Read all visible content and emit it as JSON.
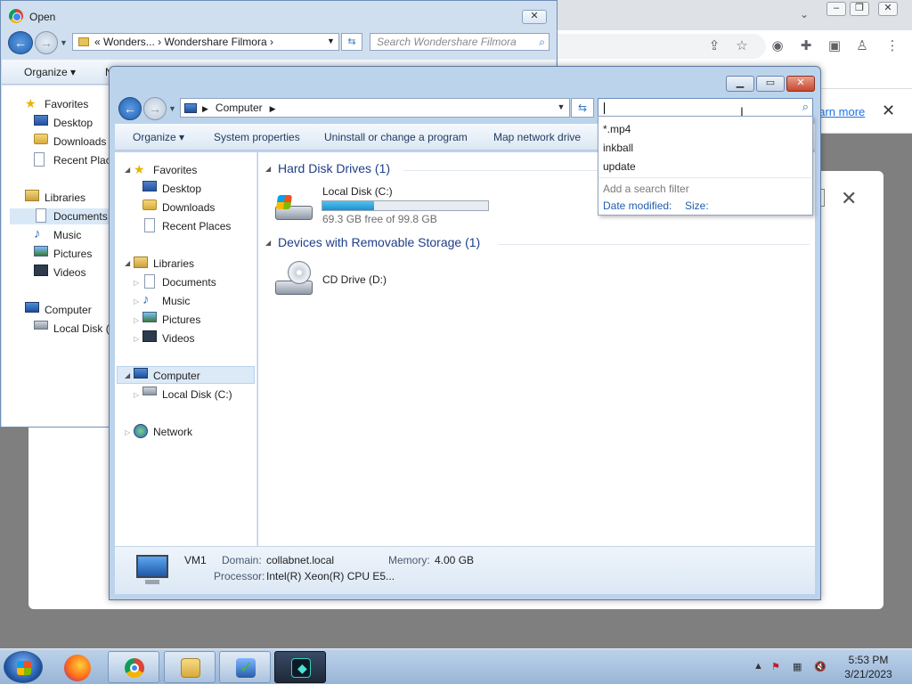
{
  "chrome": {
    "learn_more": "earn more",
    "close_glyph": "✕"
  },
  "open_dialog": {
    "title": "Open",
    "breadcrumb": "« Wonders... › Wondershare Filmora ›",
    "search_placeholder": "Search Wondershare Filmora",
    "commands": [
      "Organize ▾",
      "N"
    ],
    "nav": {
      "favorites": "Favorites",
      "desktop": "Desktop",
      "downloads": "Downloads",
      "recent": "Recent Place",
      "libraries": "Libraries",
      "documents": "Documents",
      "music": "Music",
      "pictures": "Pictures",
      "videos": "Videos",
      "computer": "Computer",
      "local_disk": "Local Disk (C"
    }
  },
  "explorer": {
    "address": "Computer",
    "commands": {
      "organize": "Organize ▾",
      "system_properties": "System properties",
      "uninstall": "Uninstall or change a program",
      "map_drive": "Map network drive"
    },
    "nav": {
      "favorites": "Favorites",
      "desktop": "Desktop",
      "downloads": "Downloads",
      "recent": "Recent Places",
      "libraries": "Libraries",
      "documents": "Documents",
      "music": "Music",
      "pictures": "Pictures",
      "videos": "Videos",
      "computer": "Computer",
      "local_disk": "Local Disk (C:)",
      "network": "Network"
    },
    "groups": {
      "hdd": "Hard Disk Drives (1)",
      "removable": "Devices with Removable Storage (1)"
    },
    "drives": {
      "c_name": "Local Disk (C:)",
      "c_free": "69.3 GB free of 99.8 GB",
      "c_used_fraction": 0.31,
      "d_name": "CD Drive (D:)"
    },
    "details": {
      "name": "VM1",
      "domain_label": "Domain:",
      "domain_value": "collabnet.local",
      "memory_label": "Memory:",
      "memory_value": "4.00 GB",
      "processor_label": "Processor:",
      "processor_value": "Intel(R) Xeon(R) CPU E5..."
    }
  },
  "search_suggest": {
    "items": [
      "*.mp4",
      "inkball",
      "update"
    ],
    "hint": "Add a search filter",
    "filter_date": "Date modified:",
    "filter_size": "Size:"
  },
  "taskbar": {
    "time": "5:53 PM",
    "date": "3/21/2023"
  },
  "colors": {
    "accent": "#1f5fae",
    "progress_fill": "#26a0da"
  }
}
